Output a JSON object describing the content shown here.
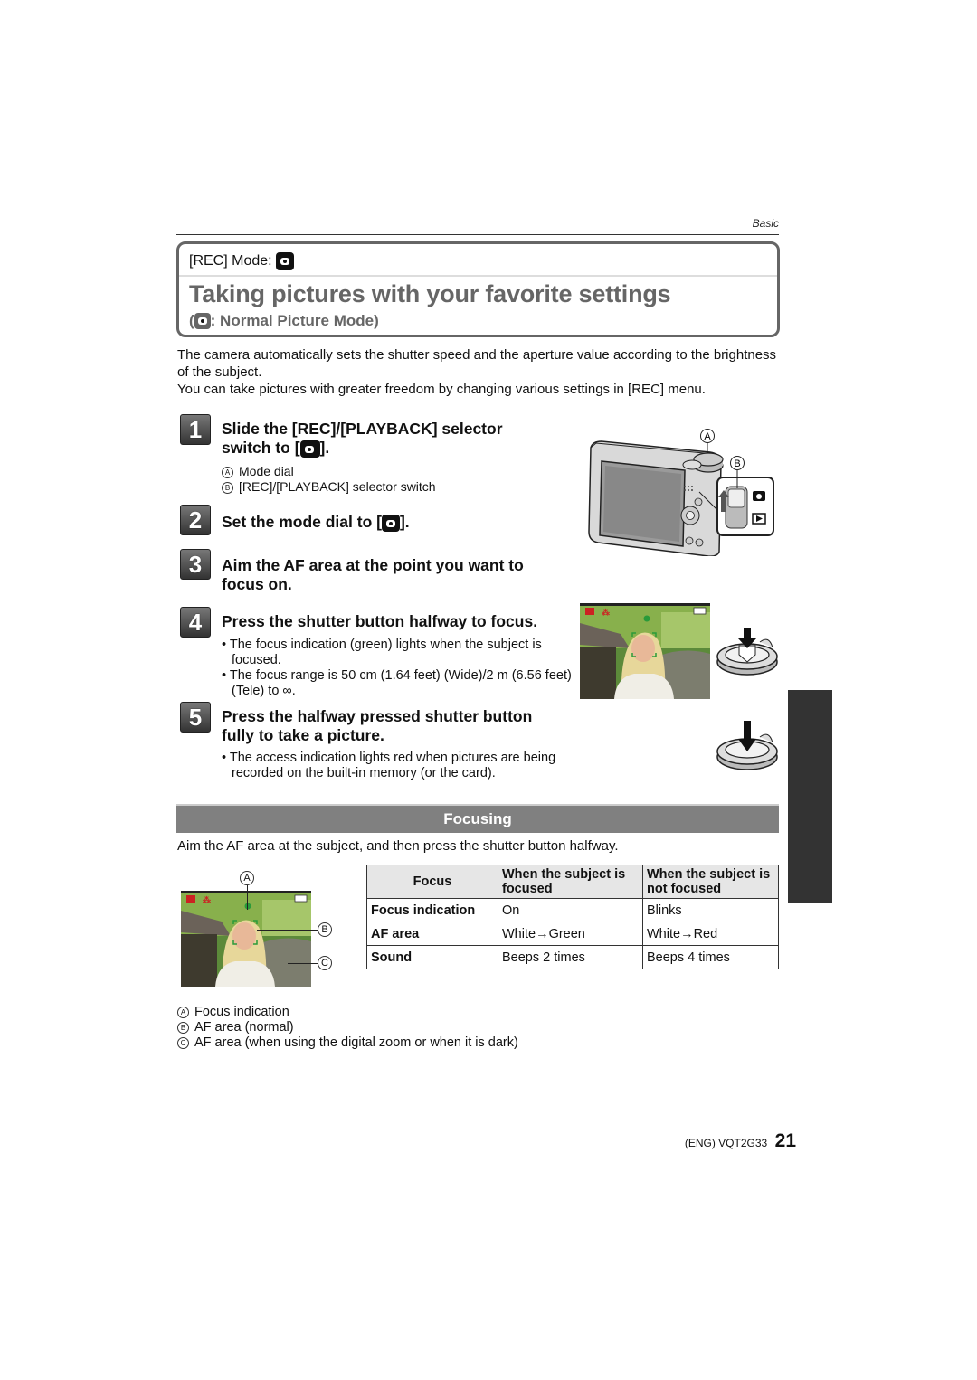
{
  "header": {
    "section_label": "Basic"
  },
  "title_box": {
    "rec_mode_label": "[REC] Mode:",
    "rec_mode_icon": "normal-picture-mode-icon",
    "title": "Taking pictures with your favorite settings",
    "subtitle_open": "(",
    "subtitle_text": ": Normal Picture Mode)"
  },
  "intro": {
    "line1": "The camera automatically sets the shutter speed and the aperture value according to the brightness of the subject.",
    "line2": "You can take pictures with greater freedom by changing various settings in [REC] menu."
  },
  "steps": [
    {
      "number": "1",
      "title_line1": "Slide the [REC]/[PLAYBACK] selector",
      "title_line2_pre": "switch to [",
      "title_line2_post": "].",
      "notes": [
        {
          "marker": "A",
          "text": "Mode dial"
        },
        {
          "marker": "B",
          "text": "[REC]/[PLAYBACK] selector switch"
        }
      ]
    },
    {
      "number": "2",
      "title_pre": "Set the mode dial to [",
      "title_post": "]."
    },
    {
      "number": "3",
      "title_line1": "Aim the AF area at the point you want to",
      "title_line2": "focus on."
    },
    {
      "number": "4",
      "title": "Press the shutter button halfway to focus.",
      "bullets": [
        "The focus indication (green) lights when the subject is focused.",
        "The focus range is 50 cm (1.64 feet) (Wide)/2 m (6.56 feet) (Tele) to ∞."
      ]
    },
    {
      "number": "5",
      "title_line1": "Press the halfway pressed shutter button",
      "title_line2": "fully to take a picture.",
      "bullets": [
        "The access indication lights red when pictures are being recorded on the built-in memory (or the card)."
      ]
    }
  ],
  "camera_figure": {
    "label_a": "A",
    "label_b": "B"
  },
  "focusing": {
    "heading": "Focusing",
    "intro": "Aim the AF area at the subject, and then press the shutter button halfway.",
    "photo_labels": {
      "a": "A",
      "b": "B",
      "c": "C"
    },
    "table": {
      "headers": [
        "Focus",
        "When the subject is focused",
        "When the subject is not focused"
      ],
      "rows": [
        [
          "Focus indication",
          "On",
          "Blinks"
        ],
        [
          "AF area",
          "White→Green",
          "White→Red"
        ],
        [
          "Sound",
          "Beeps 2 times",
          "Beeps 4 times"
        ]
      ]
    },
    "legend": [
      {
        "marker": "A",
        "text": "Focus indication"
      },
      {
        "marker": "B",
        "text": "AF area (normal)"
      },
      {
        "marker": "C",
        "text": "AF area (when using the digital zoom or when it is dark)"
      }
    ]
  },
  "footer": {
    "code": "(ENG) VQT2G33",
    "page_number": "21"
  },
  "colors": {
    "title_grey": "#666666",
    "focus_bar": "#808080",
    "side_tab": "#333333",
    "table_header_bg": "#e6e6e6",
    "focus_indicator_green": "#2a9a3a",
    "record_icon_red": "#cc2222"
  }
}
